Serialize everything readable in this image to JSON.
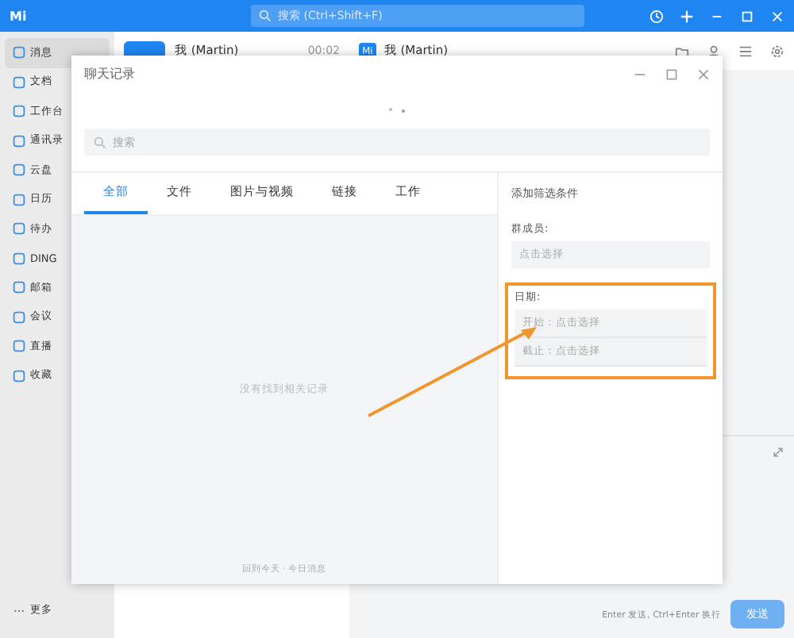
{
  "app": {
    "logo": "Mi",
    "search": {
      "placeholder": "搜索 (Ctrl+Shift+F)"
    }
  },
  "sidebar": {
    "items": [
      {
        "label": "消息",
        "selected": true
      },
      {
        "label": "文档",
        "selected": false
      },
      {
        "label": "工作台",
        "selected": false
      },
      {
        "label": "通讯录",
        "selected": false
      },
      {
        "label": "云盘",
        "selected": false
      },
      {
        "label": "日历",
        "selected": false
      },
      {
        "label": "待办",
        "selected": false
      },
      {
        "label": "DING",
        "selected": false
      },
      {
        "label": "邮箱",
        "selected": false
      },
      {
        "label": "会议",
        "selected": false
      },
      {
        "label": "直播",
        "selected": false
      },
      {
        "label": "收藏",
        "selected": false
      }
    ],
    "more": "更多"
  },
  "chat_list": {
    "header": {
      "name": "我 (Martin)",
      "time": "00:02"
    }
  },
  "chat": {
    "avatar": "Mi",
    "title": "我 (Martin)",
    "input_hint": "Enter 发送, Ctrl+Enter 换行",
    "send": "发送"
  },
  "dialog": {
    "title": "聊天记录",
    "search": {
      "placeholder": "搜索"
    },
    "tabs": [
      {
        "label": "全部",
        "selected": true
      },
      {
        "label": "文件",
        "selected": false
      },
      {
        "label": "图片与视频",
        "selected": false
      },
      {
        "label": "链接",
        "selected": false
      },
      {
        "label": "工作",
        "selected": false
      }
    ],
    "empty": "没有找到相关记录",
    "footer": "回到今天 · 今日消息",
    "filters": {
      "title": "添加筛选条件",
      "member_label": "群成员:",
      "member_placeholder": "点击选择",
      "date_label": "日期:",
      "start": "开始：点击选择",
      "end": "截止：点击选择"
    }
  }
}
